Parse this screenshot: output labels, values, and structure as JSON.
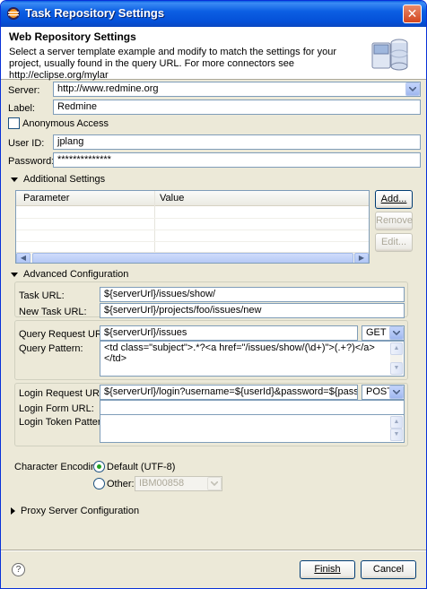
{
  "window": {
    "title": "Task Repository Settings",
    "close_glyph": "✕"
  },
  "banner": {
    "title": "Web Repository Settings",
    "description": "Select a server template example and modify to match the settings for your project, usually found in the query URL.  For more connectors see http://eclipse.org/mylar",
    "icon": "repository-icon"
  },
  "form": {
    "server_label": "Server:",
    "server_value": "http://www.redmine.org",
    "label_label": "Label:",
    "label_value": "Redmine",
    "anonymous_label": "Anonymous Access",
    "anonymous_checked": false,
    "userid_label": "User ID:",
    "userid_value": "jplang",
    "password_label": "Password:",
    "password_value": "**************"
  },
  "additional": {
    "title": "Additional Settings",
    "columns": [
      "Parameter",
      "Value"
    ],
    "buttons": {
      "add": "Add...",
      "remove": "Remove",
      "edit": "Edit..."
    }
  },
  "advanced": {
    "title": "Advanced Configuration",
    "task_url_label": "Task URL:",
    "task_url_value": "${serverUrl}/issues/show/",
    "new_task_url_label": "New Task URL:",
    "new_task_url_value": "${serverUrl}/projects/foo/issues/new",
    "query_request_label": "Query Request URL:",
    "query_request_value": "${serverUrl}/issues",
    "query_method": "GET",
    "query_pattern_label": "Query Pattern:",
    "query_pattern_value": "<td class=\"subject\">.*?<a href=\"/issues/show/(\\d+)\">(.+?)</a></td>",
    "login_request_label": "Login Request URL:",
    "login_request_value": "${serverUrl}/login?username=${userId}&password=${password}",
    "login_method": "POST",
    "login_form_label": "Login Form URL:",
    "login_form_value": "",
    "login_token_label": "Login Token Pattern:",
    "login_token_value": ""
  },
  "encoding": {
    "label": "Character Encoding:",
    "default_option": "Default (UTF-8)",
    "other_option": "Other:",
    "other_value": "IBM00858",
    "selected": "default"
  },
  "proxy": {
    "title": "Proxy Server Configuration"
  },
  "footer": {
    "help_glyph": "?",
    "finish": "Finish",
    "cancel": "Cancel"
  },
  "colors": {
    "titlebar": "#0c5fe3",
    "dialog_bg": "#ece9d8",
    "field_border": "#7f9db9",
    "radio_dot": "#21a121"
  }
}
